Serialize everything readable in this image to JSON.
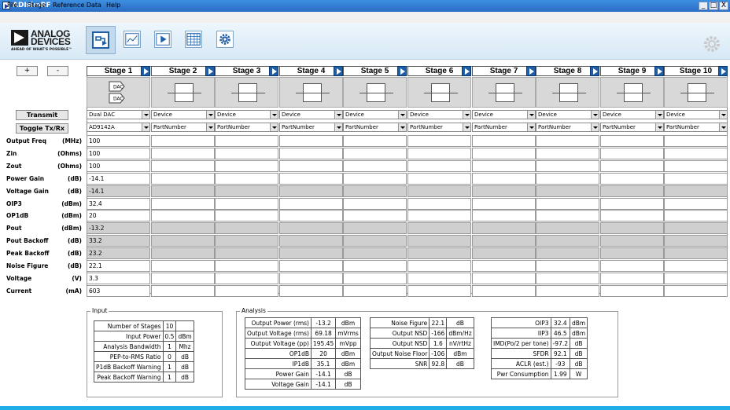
{
  "window": {
    "title": "ADIsimRF",
    "minimize": "_",
    "maximize": "□",
    "close": "X"
  },
  "menu": [
    "File",
    "Stage",
    "Reference Data",
    "Help"
  ],
  "logo": {
    "line1": "ANALOG",
    "line2": "DEVICES",
    "tagline": "AHEAD OF WHAT'S POSSIBLE™"
  },
  "toolbar": {
    "icons": [
      "signal-chain-icon",
      "plot-icon",
      "play-icon",
      "table-icon",
      "gear-icon"
    ]
  },
  "side": {
    "plus_label": "+",
    "minus_label": "-",
    "transmit_label": "Transmit",
    "toggle_label": "Toggle Tx/Rx"
  },
  "rows": [
    {
      "label": "Output Freq",
      "unit": "(MHz)"
    },
    {
      "label": "Zin",
      "unit": "(Ohms)"
    },
    {
      "label": "Zout",
      "unit": "(Ohms)"
    },
    {
      "label": "Power Gain",
      "unit": "(dB)"
    },
    {
      "label": "Voltage Gain",
      "unit": "(dB)"
    },
    {
      "label": "OIP3",
      "unit": "(dBm)"
    },
    {
      "label": "OP1dB",
      "unit": "(dBm)"
    },
    {
      "label": "Pout",
      "unit": "(dBm)"
    },
    {
      "label": "Pout Backoff",
      "unit": "(dB)"
    },
    {
      "label": "Peak Backoff",
      "unit": "(dB)"
    },
    {
      "label": "Noise Figure",
      "unit": "(dB)"
    },
    {
      "label": "Voltage",
      "unit": "(V)"
    },
    {
      "label": "Current",
      "unit": "(mA)"
    }
  ],
  "stages": [
    {
      "name": "Stage 1",
      "device": "Dual DAC",
      "part": "AD9142A",
      "values": [
        "100",
        "100",
        "100",
        "-14.1",
        "-14.1",
        "32.4",
        "20",
        "-13.2",
        "33.2",
        "23.2",
        "22.1",
        "3.3",
        "603"
      ]
    },
    {
      "name": "Stage 2",
      "device": "Device",
      "part": "PartNumber"
    },
    {
      "name": "Stage 3",
      "device": "Device",
      "part": "PartNumber"
    },
    {
      "name": "Stage 4",
      "device": "Device",
      "part": "PartNumber"
    },
    {
      "name": "Stage 5",
      "device": "Device",
      "part": "PartNumber"
    },
    {
      "name": "Stage 6",
      "device": "Device",
      "part": "PartNumber"
    },
    {
      "name": "Stage 7",
      "device": "Device",
      "part": "PartNumber"
    },
    {
      "name": "Stage 8",
      "device": "Device",
      "part": "PartNumber"
    },
    {
      "name": "Stage 9",
      "device": "Device",
      "part": "PartNumber"
    },
    {
      "name": "Stage 10",
      "device": "Device",
      "part": "PartNumber"
    }
  ],
  "stage1_block": {
    "dac_top": "DAC",
    "dac_bottom": "DAC"
  },
  "input_panel": {
    "title": "Input",
    "rows": [
      [
        "Number of Stages",
        "10",
        ""
      ],
      [
        "Input Power",
        "0.5",
        "dBm"
      ],
      [
        "Analysis Bandwidth",
        "1",
        "Mhz"
      ],
      [
        "PEP-to-RMS Ratio",
        "0",
        "dB"
      ],
      [
        "P1dB Backoff Warning",
        "1",
        "dB"
      ],
      [
        "Peak Backoff Warning",
        "1",
        "dB"
      ]
    ]
  },
  "analysis_panel": {
    "title": "Analysis",
    "col1": [
      [
        "Output Power (rms)",
        "-13.2",
        "dBm"
      ],
      [
        "Output Voltage (rms)",
        "69.18",
        "mVrms"
      ],
      [
        "Output Voltage (pp)",
        "195.45",
        "mVpp"
      ],
      [
        "OP1dB",
        "20",
        "dBm"
      ],
      [
        "IP1dB",
        "35.1",
        "dBm"
      ],
      [
        "Power Gain",
        "-14.1",
        "dB"
      ],
      [
        "Voltage Gain",
        "-14.1",
        "dB"
      ]
    ],
    "col2": [
      [
        "Noise Figure",
        "22.1",
        "dB"
      ],
      [
        "Output NSD",
        "-166",
        "dBm/Hz"
      ],
      [
        "Output NSD",
        "1.6",
        "nV/rtHz"
      ],
      [
        "Output Noise Floor",
        "-106",
        "dBm"
      ],
      [
        "SNR",
        "92.8",
        "dB"
      ]
    ],
    "col3": [
      [
        "OIP3",
        "32.4",
        "dBm"
      ],
      [
        "IIP3",
        "46.5",
        "dBm"
      ],
      [
        "IMD(Po/2 per tone)",
        "-97.2",
        "dB"
      ],
      [
        "SFDR",
        "92.1",
        "dB"
      ],
      [
        "ACLR (est.)",
        "-93",
        "dB"
      ],
      [
        "Pwr Consumption",
        "1.99",
        "W"
      ]
    ]
  }
}
